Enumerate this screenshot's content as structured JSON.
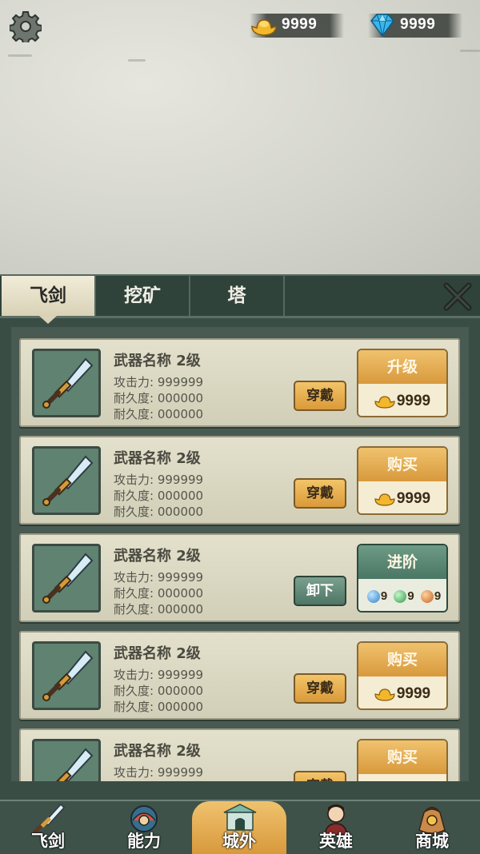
{
  "resources": {
    "gold": {
      "value": "9999",
      "icon": "gold-ingot-icon"
    },
    "diamond": {
      "value": "9999",
      "icon": "diamond-icon"
    }
  },
  "tabs": [
    {
      "label": "飞剑",
      "active": true
    },
    {
      "label": "挖矿",
      "active": false
    },
    {
      "label": "塔",
      "active": false
    }
  ],
  "labels": {
    "attack": "攻击力:",
    "durability": "耐久度:"
  },
  "items": [
    {
      "name": "武器名称 2级",
      "attack": "999999",
      "durability1": "000000",
      "durability2": "000000",
      "equip_label": "穿戴",
      "action_label": "升级",
      "cost": "9999",
      "action_type": "gold"
    },
    {
      "name": "武器名称 2级",
      "attack": "999999",
      "durability1": "000000",
      "durability2": "000000",
      "equip_label": "穿戴",
      "action_label": "购买",
      "cost": "9999",
      "action_type": "gold"
    },
    {
      "name": "武器名称 2级",
      "attack": "999999",
      "durability1": "000000",
      "durability2": "000000",
      "equip_label": "卸下",
      "action_label": "进阶",
      "gems": [
        "9",
        "9",
        "9"
      ],
      "action_type": "gems"
    },
    {
      "name": "武器名称 2级",
      "attack": "999999",
      "durability1": "000000",
      "durability2": "000000",
      "equip_label": "穿戴",
      "action_label": "购买",
      "cost": "9999",
      "action_type": "gold"
    },
    {
      "name": "武器名称 2级",
      "attack": "999999",
      "equip_label": "穿戴",
      "action_label": "购买",
      "action_type": "gold"
    }
  ],
  "nav": [
    {
      "label": "飞剑",
      "icon": "sword-icon"
    },
    {
      "label": "能力",
      "icon": "ability-icon"
    },
    {
      "label": "城外",
      "icon": "gate-icon",
      "active": true
    },
    {
      "label": "英雄",
      "icon": "hero-icon"
    },
    {
      "label": "商城",
      "icon": "shop-bag-icon"
    }
  ],
  "colors": {
    "accent_gold": "#e2a445",
    "panel_green": "#3a4d45",
    "card_beige": "#dcd8c2",
    "green_button": "#5a8572"
  }
}
